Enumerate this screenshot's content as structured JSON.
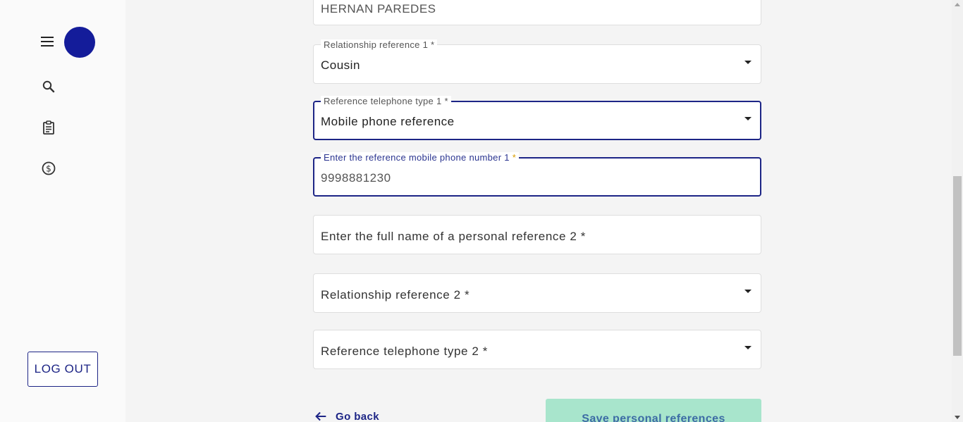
{
  "sidebar": {
    "logout_label": "LOG OUT"
  },
  "icons": {
    "menu": "hamburger-menu-icon",
    "search": "search-icon",
    "clipboard": "clipboard-icon",
    "money": "dollar-circle-icon",
    "back": "arrow-left-icon"
  },
  "colors": {
    "brand": "#1d2586",
    "avatar": "#141c9a",
    "save_button_bg": "#a8e5cc",
    "required_marker_focused": "#d99d00"
  },
  "form": {
    "full_name_1": {
      "value": "HERNAN PAREDES"
    },
    "relationship_1": {
      "label": "Relationship reference 1 *",
      "value": "Cousin"
    },
    "telephone_type_1": {
      "label": "Reference telephone type 1 *",
      "value": "Mobile phone reference"
    },
    "mobile_number_1": {
      "label_text": "Enter the reference mobile phone number 1 ",
      "label_marker": "*",
      "value": "9998881230"
    },
    "full_name_2": {
      "placeholder": "Enter the full name of a personal reference 2 *"
    },
    "relationship_2": {
      "placeholder": "Relationship reference 2 *"
    },
    "telephone_type_2": {
      "placeholder": "Reference telephone type 2 *"
    }
  },
  "actions": {
    "go_back_label": "Go back",
    "save_label": "Save personal references"
  }
}
